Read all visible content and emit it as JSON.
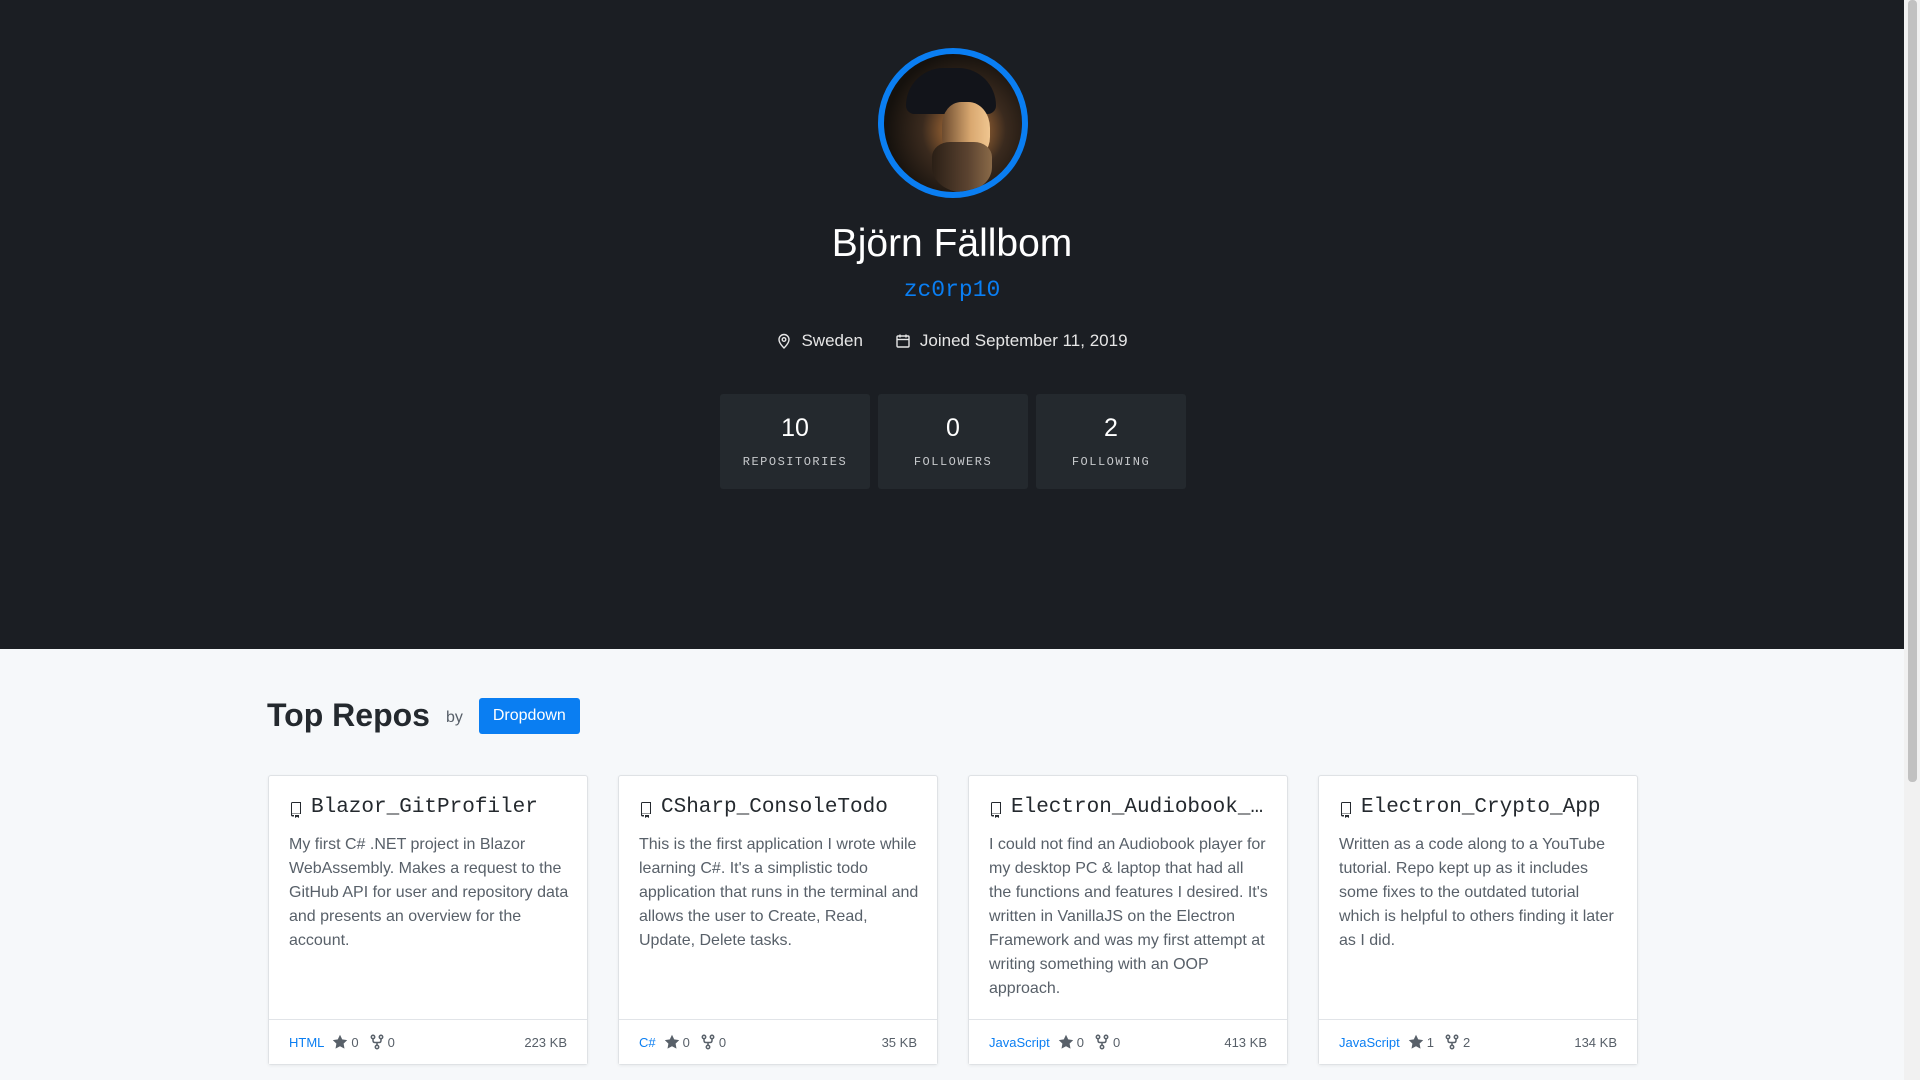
{
  "profile": {
    "name": "Björn Fällbom",
    "login": "zc0rp10",
    "location": "Sweden",
    "joined": "Joined September 11, 2019",
    "location_icon": "map-pin-icon",
    "joined_icon": "calendar-icon"
  },
  "stats": [
    {
      "value": "10",
      "label": "REPOSITORIES"
    },
    {
      "value": "0",
      "label": "FOLLOWERS"
    },
    {
      "value": "2",
      "label": "FOLLOWING"
    }
  ],
  "repos_section": {
    "title": "Top Repos",
    "by": "by",
    "dropdown_label": "Dropdown"
  },
  "repos": [
    {
      "name": "Blazor_GitProfiler",
      "description": "My first C# .NET project in Blazor WebAssembly. Makes a request to the GitHub API for user and repository data and presents an overview for the account.",
      "language": "HTML",
      "stars": "0",
      "forks": "0",
      "size": "223 KB"
    },
    {
      "name": "CSharp_ConsoleTodo",
      "description": "This is the first application I wrote while learning C#. It's a simplistic todo application that runs in the terminal and allows the user to Create, Read, Update, Delete tasks.",
      "language": "C#",
      "stars": "0",
      "forks": "0",
      "size": "35 KB"
    },
    {
      "name": "Electron_Audiobook_Player",
      "description": "I could not find an Audiobook player for my desktop PC & laptop that had all the functions and features I desired. It's written in VanillaJS on the Electron Framework and was my first attempt at writing something with an OOP approach.",
      "language": "JavaScript",
      "stars": "0",
      "forks": "0",
      "size": "413 KB"
    },
    {
      "name": "Electron_Crypto_App",
      "description": "Written as a code along to a YouTube tutorial. Repo kept up as it includes some fixes to the outdated tutorial which is helpful to others finding it later as I did.",
      "language": "JavaScript",
      "stars": "1",
      "forks": "2",
      "size": "134 KB"
    }
  ],
  "colors": {
    "accent": "#0a7ef2",
    "hero_bg": "#1b1e23",
    "stat_bg": "#24292e",
    "page_bg": "#f6f8fa"
  }
}
